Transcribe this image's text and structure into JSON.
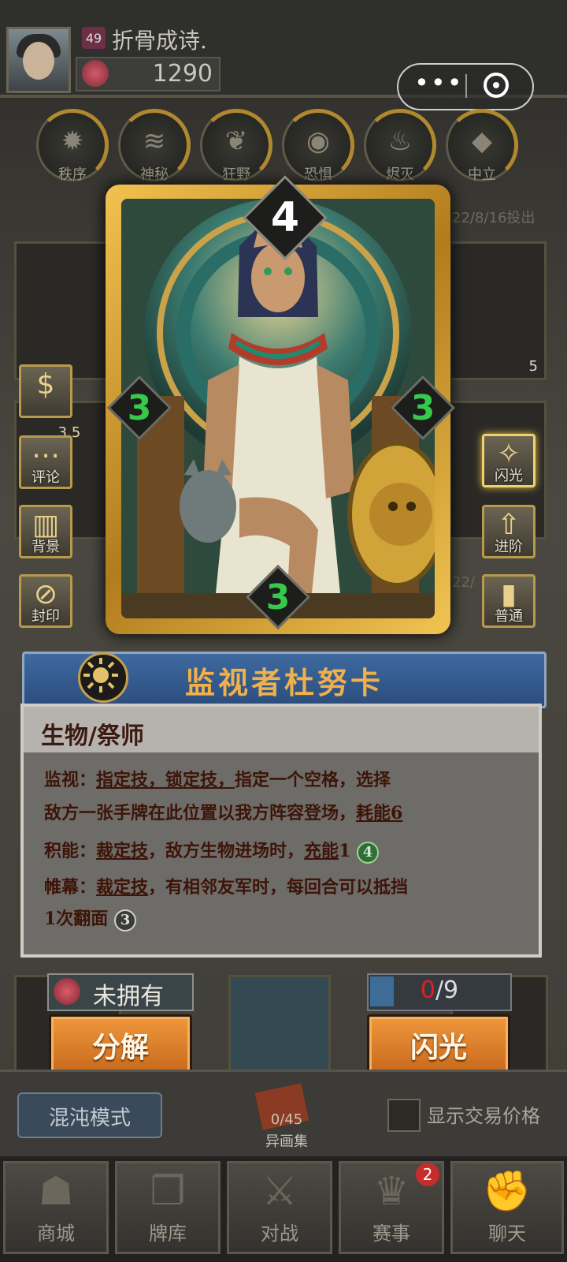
{
  "player": {
    "level": "49",
    "name": "折骨成诗.",
    "currency": "1290"
  },
  "factions": [
    "秩序",
    "神秘",
    "狂野",
    "恐惧",
    "烬灭",
    "中立"
  ],
  "dates": [
    "22/8/16投出",
    "22/"
  ],
  "side_left": {
    "trade_glyph": "$",
    "rating": "3.5",
    "comment": "评论",
    "background": "背景",
    "seal": "封印"
  },
  "side_right": {
    "flash": "闪光",
    "advance": "进阶",
    "normal": "普通"
  },
  "card": {
    "cost": "4",
    "left_stat": "3",
    "right_stat": "3",
    "bottom_stat": "3",
    "name": "监视者杜努卡",
    "type": "生物/祭师",
    "ghost_count": "5",
    "abilities": {
      "a1_label": "监视：",
      "a1_kw": "指定技，锁定技，",
      "a1_text": "指定一个空格，选择",
      "a1_text2": "敌方一张手牌在此位置以我方阵容登场，",
      "a1_kw2": "耗能6",
      "a2_label": "积能：",
      "a2_kw": "裁定技",
      "a2_text": "，敌方生物进场时，",
      "a2_kw2": "充能",
      "a2_num": "1",
      "a2_circle": "4",
      "a3_label": "帷幕：",
      "a3_kw": "裁定技",
      "a3_text": "，有相邻友军时，每回合可以抵挡",
      "a3_text2": "1次翻面",
      "a3_circle": "3"
    },
    "colors": {
      "frame": "#e6b440",
      "stat_green": "#37c94a",
      "name_orange": "#f0b04a"
    }
  },
  "ownership": {
    "status": "未拥有",
    "progress_have": "0",
    "progress_total": "/9",
    "progress_fraction": 0.0
  },
  "buttons": {
    "decompose": "分解",
    "flash": "闪光",
    "chaos_mode": "混沌模式",
    "album_count": "0/45",
    "album_label": "异画集",
    "show_trade_price": "显示交易价格"
  },
  "nav": {
    "items": [
      "商城",
      "牌库",
      "对战",
      "赛事",
      "聊天"
    ],
    "badge": "2"
  }
}
